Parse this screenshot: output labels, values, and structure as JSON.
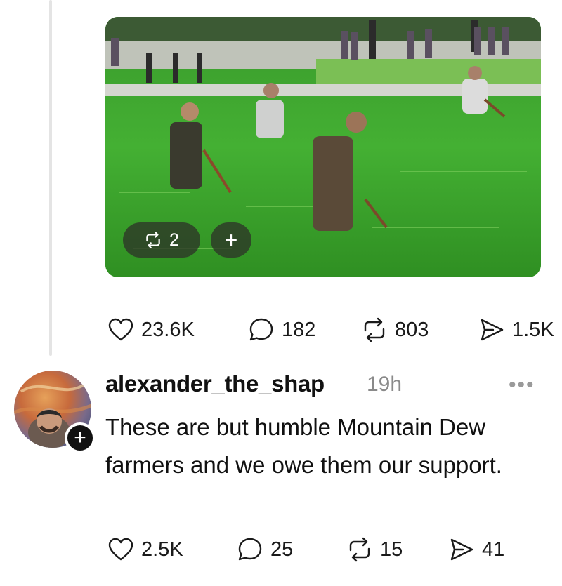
{
  "media": {
    "repost_count": "2",
    "add_label": "+"
  },
  "original_post": {
    "likes": "23.6K",
    "replies": "182",
    "reposts": "803",
    "shares": "1.5K"
  },
  "reply": {
    "username": "alexander_the_shap",
    "timestamp": "19h",
    "more_label": "•••",
    "follow_label": "+",
    "text": "These are but humble Mountain Dew farmers and we owe them our support.",
    "likes": "2.5K",
    "replies": "25",
    "reposts": "15",
    "shares": "41"
  },
  "icons": [
    "heart-icon",
    "comment-icon",
    "repost-icon",
    "send-icon",
    "plus-icon",
    "more-icon"
  ]
}
